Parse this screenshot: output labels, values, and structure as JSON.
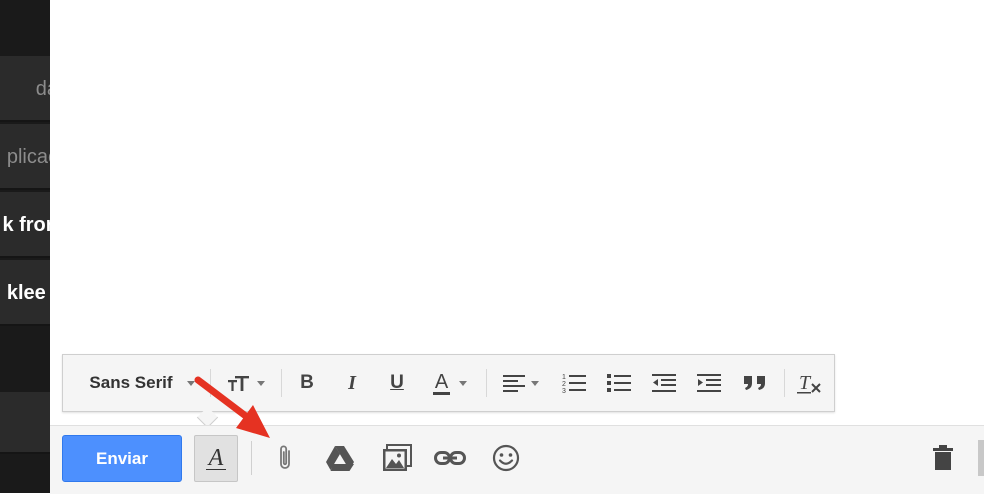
{
  "inbox_rows": [
    {
      "text": "da",
      "bold": false
    },
    {
      "text": "plicac",
      "bold": false
    },
    {
      "text": "k fron",
      "bold": true
    },
    {
      "text": "klee (",
      "bold": true
    }
  ],
  "format_toolbar": {
    "font": "Sans Serif",
    "font_size_icon": "text-size-icon",
    "bold": "B",
    "italic": "I",
    "underline": "U",
    "text_color": "A",
    "tools": [
      "bold-icon",
      "italic-icon",
      "underline-icon",
      "text-color-icon",
      "align-icon",
      "numbered-list-icon",
      "bulleted-list-icon",
      "indent-less-icon",
      "indent-more-icon",
      "quote-icon",
      "remove-formatting-icon"
    ]
  },
  "action_bar": {
    "send_label": "Enviar",
    "formatting_toggle": "A",
    "icons": [
      "attach-file-icon",
      "google-drive-icon",
      "insert-photo-icon",
      "insert-link-icon",
      "insert-emoji-icon",
      "discard-trash-icon"
    ]
  },
  "colors": {
    "send_button": "#4d90fe",
    "annotation_arrow": "#e53222",
    "dark_sidebar": "#1a1a1a"
  }
}
